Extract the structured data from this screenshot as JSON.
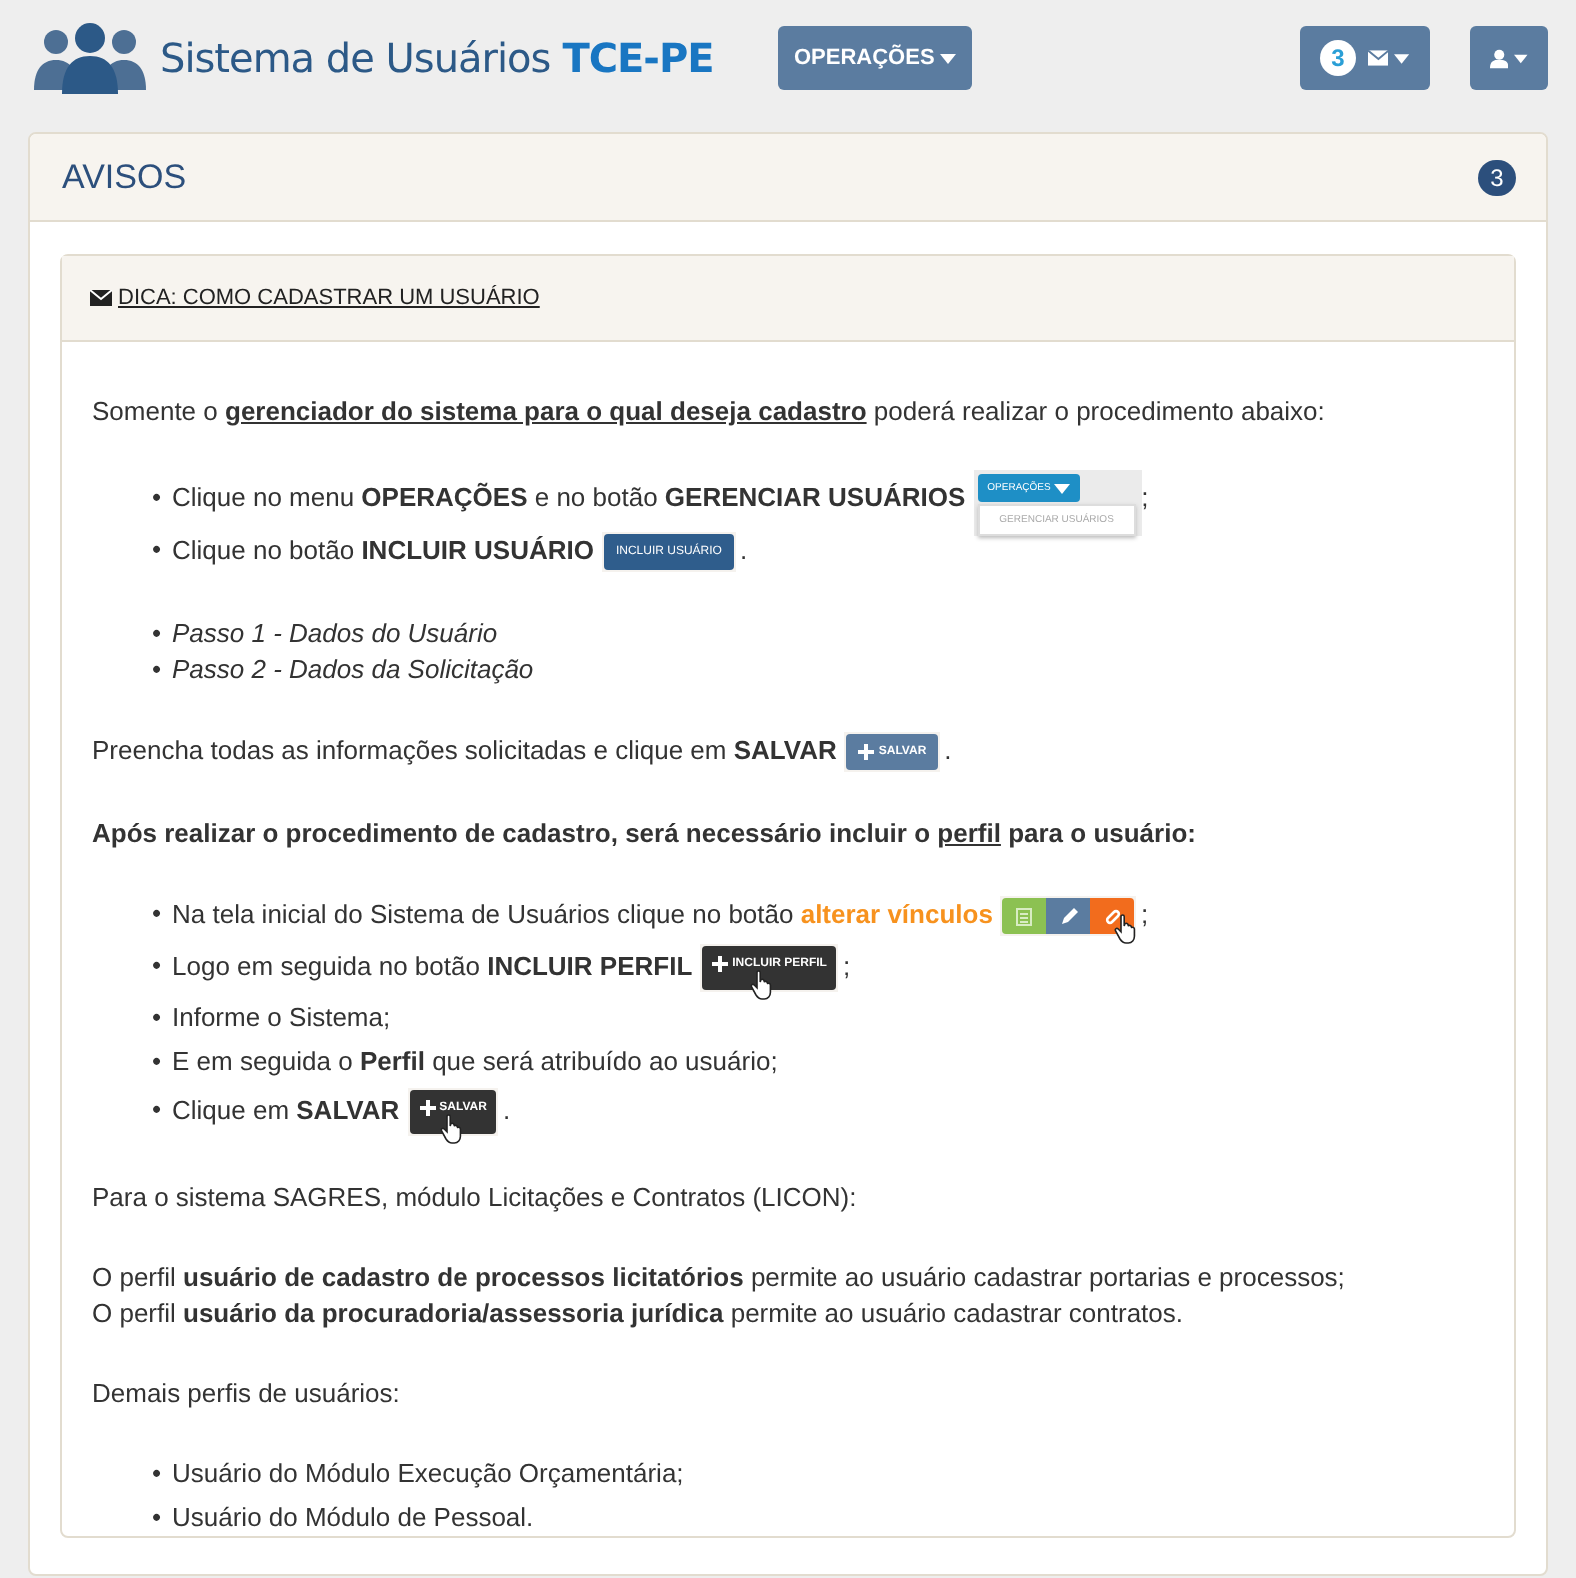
{
  "header": {
    "title": "Sistema de Usuários",
    "title_suffix": "TCE-PE",
    "menu": "OPERAÇÕES",
    "mail_count": "3"
  },
  "panel": {
    "title": "AVISOS",
    "count": "3"
  },
  "notice": {
    "title": "DICA: COMO CADASTRAR UM USUÁRIO",
    "blocks": [
      {
        "kind": "paragraph",
        "segments": [
          {
            "kind": "plain",
            "text": "Somente o "
          },
          {
            "kind": "strong-underlined",
            "text": "gerenciador do sistema para o qual deseja cadastro"
          },
          {
            "kind": "plain",
            "text": " poderá realizar o procedimento abaixo:"
          }
        ]
      },
      {
        "kind": "bullets",
        "items": [
          {
            "marker": "•",
            "segments": [
              {
                "kind": "plain",
                "text": "Clique no menu "
              },
              {
                "kind": "strong",
                "text": "OPERAÇÕES"
              },
              {
                "kind": "plain",
                "text": " e no botão "
              },
              {
                "kind": "strong",
                "text": "GERENCIAR USUÁRIOS"
              }
            ],
            "shot": {
              "kind": "menu-shot",
              "label": "OPERAÇÕES",
              "item": "GERENCIAR USUÁRIOS"
            },
            "after": ";"
          },
          {
            "marker": "•",
            "segments": [
              {
                "kind": "plain",
                "text": "Clique no botão "
              },
              {
                "kind": "strong",
                "text": "INCLUIR USUÁRIO"
              }
            ],
            "shot": {
              "kind": "primary-shot",
              "label": "INCLUIR USUÁRIO"
            },
            "after": "."
          }
        ]
      },
      {
        "kind": "italic-bullets",
        "items": [
          {
            "marker": "•",
            "segments": [
              {
                "kind": "plain",
                "text": "Passo 1 - Dados do Usuário"
              }
            ]
          },
          {
            "marker": "•",
            "segments": [
              {
                "kind": "plain",
                "text": "Passo 2 - Dados da Solicitação"
              }
            ]
          }
        ]
      },
      {
        "kind": "paragraph",
        "segments": [
          {
            "kind": "plain",
            "text": "Preencha todas as informações solicitadas e clique em "
          },
          {
            "kind": "strong",
            "text": "SALVAR"
          }
        ],
        "shot": {
          "kind": "save-shot",
          "label": "SALVAR"
        },
        "after": "."
      },
      {
        "kind": "paragraph",
        "segments": [
          {
            "kind": "strong",
            "text": "Após realizar o procedimento de cadastro, será necessário incluir o "
          },
          {
            "kind": "strong-underlined",
            "text": "perfil"
          },
          {
            "kind": "strong",
            "text": " para o usuário:"
          }
        ]
      },
      {
        "kind": "bullets",
        "items": [
          {
            "marker": "•",
            "segments": [
              {
                "kind": "plain",
                "text": "Na tela inicial do Sistema de Usuários clique no botão "
              },
              {
                "kind": "highlight",
                "text": "alterar vínculos"
              }
            ],
            "shot": {
              "kind": "actions-shot"
            },
            "after": ";"
          },
          {
            "marker": "•",
            "segments": [
              {
                "kind": "plain",
                "text": "Logo em seguida no botão "
              },
              {
                "kind": "strong",
                "text": "INCLUIR PERFIL"
              }
            ],
            "shot": {
              "kind": "dark-shot",
              "label": "INCLUIR PERFIL"
            },
            "after": ";"
          },
          {
            "marker": "•",
            "segments": [
              {
                "kind": "plain",
                "text": "Informe o Sistema;"
              }
            ]
          },
          {
            "marker": "•",
            "segments": [
              {
                "kind": "plain",
                "text": "E em seguida o "
              },
              {
                "kind": "strong",
                "text": "Perfil"
              },
              {
                "kind": "plain",
                "text": " que será atribuído ao usuário;"
              }
            ]
          },
          {
            "marker": "•",
            "segments": [
              {
                "kind": "plain",
                "text": "Clique em "
              },
              {
                "kind": "strong",
                "text": "SALVAR"
              }
            ],
            "shot": {
              "kind": "dark-shot",
              "label": "SALVAR"
            },
            "after": "."
          }
        ]
      },
      {
        "kind": "paragraph",
        "segments": [
          {
            "kind": "plain",
            "text": "Para o sistema SAGRES, módulo Licitações e Contratos (LICON):"
          }
        ]
      },
      {
        "kind": "lines",
        "items": [
          {
            "segments": [
              {
                "kind": "plain",
                "text": "O perfil "
              },
              {
                "kind": "strong",
                "text": "usuário de cadastro de processos licitatórios"
              },
              {
                "kind": "plain",
                "text": " permite ao usuário cadastrar portarias e processos;"
              }
            ]
          },
          {
            "segments": [
              {
                "kind": "plain",
                "text": "O perfil "
              },
              {
                "kind": "strong",
                "text": "usuário da procuradoria/assessoria jurídica"
              },
              {
                "kind": "plain",
                "text": " permite ao usuário cadastrar contratos."
              }
            ]
          }
        ]
      },
      {
        "kind": "paragraph",
        "segments": [
          {
            "kind": "plain",
            "text": "Demais perfis de usuários:"
          }
        ]
      },
      {
        "kind": "bullets",
        "items": [
          {
            "marker": "•",
            "segments": [
              {
                "kind": "plain",
                "text": "Usuário do Módulo Execução Orçamentária;"
              }
            ]
          },
          {
            "marker": "•",
            "segments": [
              {
                "kind": "plain",
                "text": "Usuário do Módulo de Pessoal."
              }
            ]
          }
        ]
      }
    ]
  }
}
